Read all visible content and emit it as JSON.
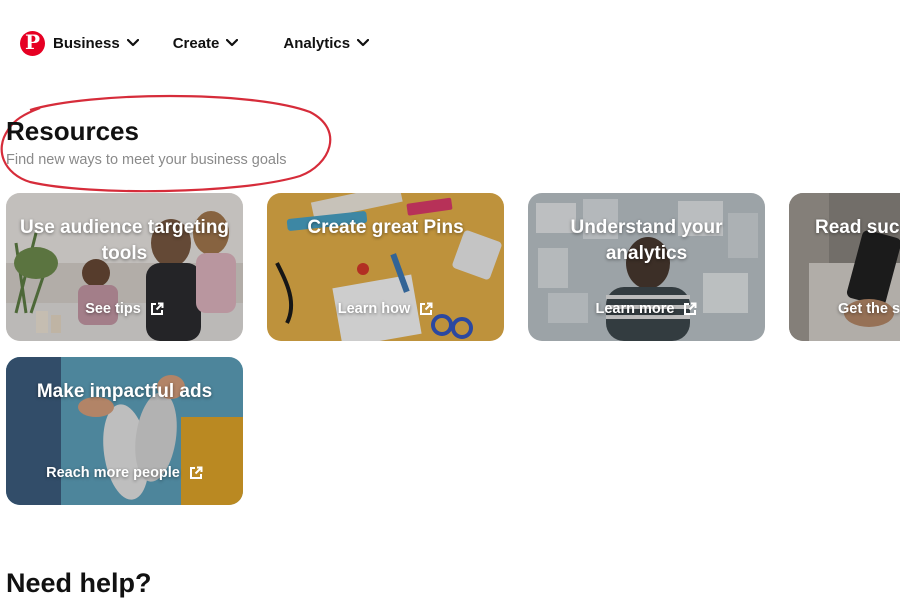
{
  "nav": {
    "logo_letter": "P",
    "items": [
      {
        "label": "Business"
      },
      {
        "label": "Create"
      },
      {
        "label": "Analytics"
      }
    ]
  },
  "resources": {
    "title": "Resources",
    "subtitle": "Find new ways to meet your business goals"
  },
  "cards": [
    {
      "title": "Use audience targeting tools",
      "link": "See tips"
    },
    {
      "title": "Create great Pins",
      "link": "Learn how"
    },
    {
      "title": "Understand your analytics",
      "link": "Learn more"
    },
    {
      "title": "Read suc",
      "link": "Get the s"
    },
    {
      "title": "Make impactful ads",
      "link": "Reach more people"
    }
  ],
  "help": {
    "title": "Need help?"
  },
  "colors": {
    "brand": "#E60023",
    "annotation_circle": "#D62C3A",
    "card2_bg": "#E8B24A"
  },
  "icons": {
    "logo": "pinterest-logo",
    "nav_chevron": "chevron-down-icon",
    "card_link": "external-link-icon"
  }
}
